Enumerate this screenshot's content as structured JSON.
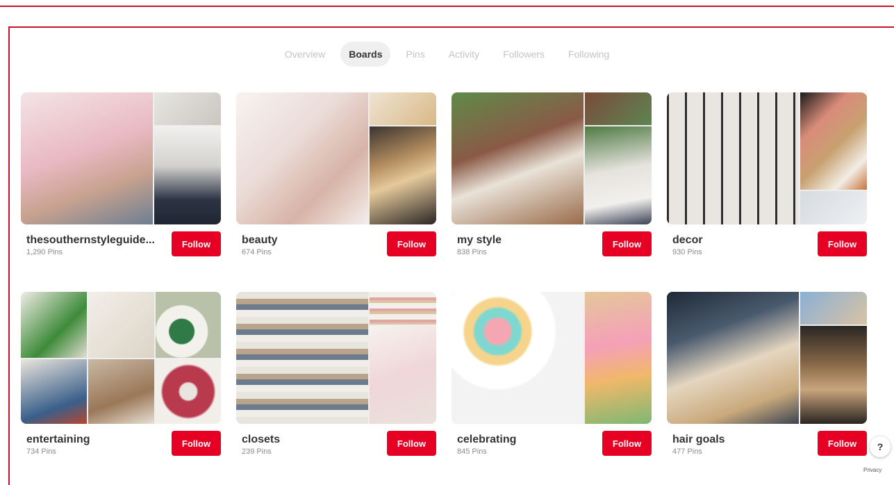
{
  "tabs": [
    {
      "label": "Overview"
    },
    {
      "label": "Boards"
    },
    {
      "label": "Pins"
    },
    {
      "label": "Activity"
    },
    {
      "label": "Followers"
    },
    {
      "label": "Following"
    }
  ],
  "active_tab": "Boards",
  "follow_label": "Follow",
  "boards": [
    {
      "name": "thesouthernstyleguide...",
      "pins": "1,290 Pins"
    },
    {
      "name": "beauty",
      "pins": "674 Pins"
    },
    {
      "name": "my style",
      "pins": "838 Pins"
    },
    {
      "name": "decor",
      "pins": "930 Pins"
    },
    {
      "name": "entertaining",
      "pins": "734 Pins"
    },
    {
      "name": "closets",
      "pins": "239 Pins"
    },
    {
      "name": "celebrating",
      "pins": "845 Pins"
    },
    {
      "name": "hair goals",
      "pins": "477 Pins"
    }
  ],
  "help_label": "?",
  "privacy_label": "Privacy",
  "colors": {
    "accent": "#c8102e",
    "follow_button": "#e60023"
  }
}
